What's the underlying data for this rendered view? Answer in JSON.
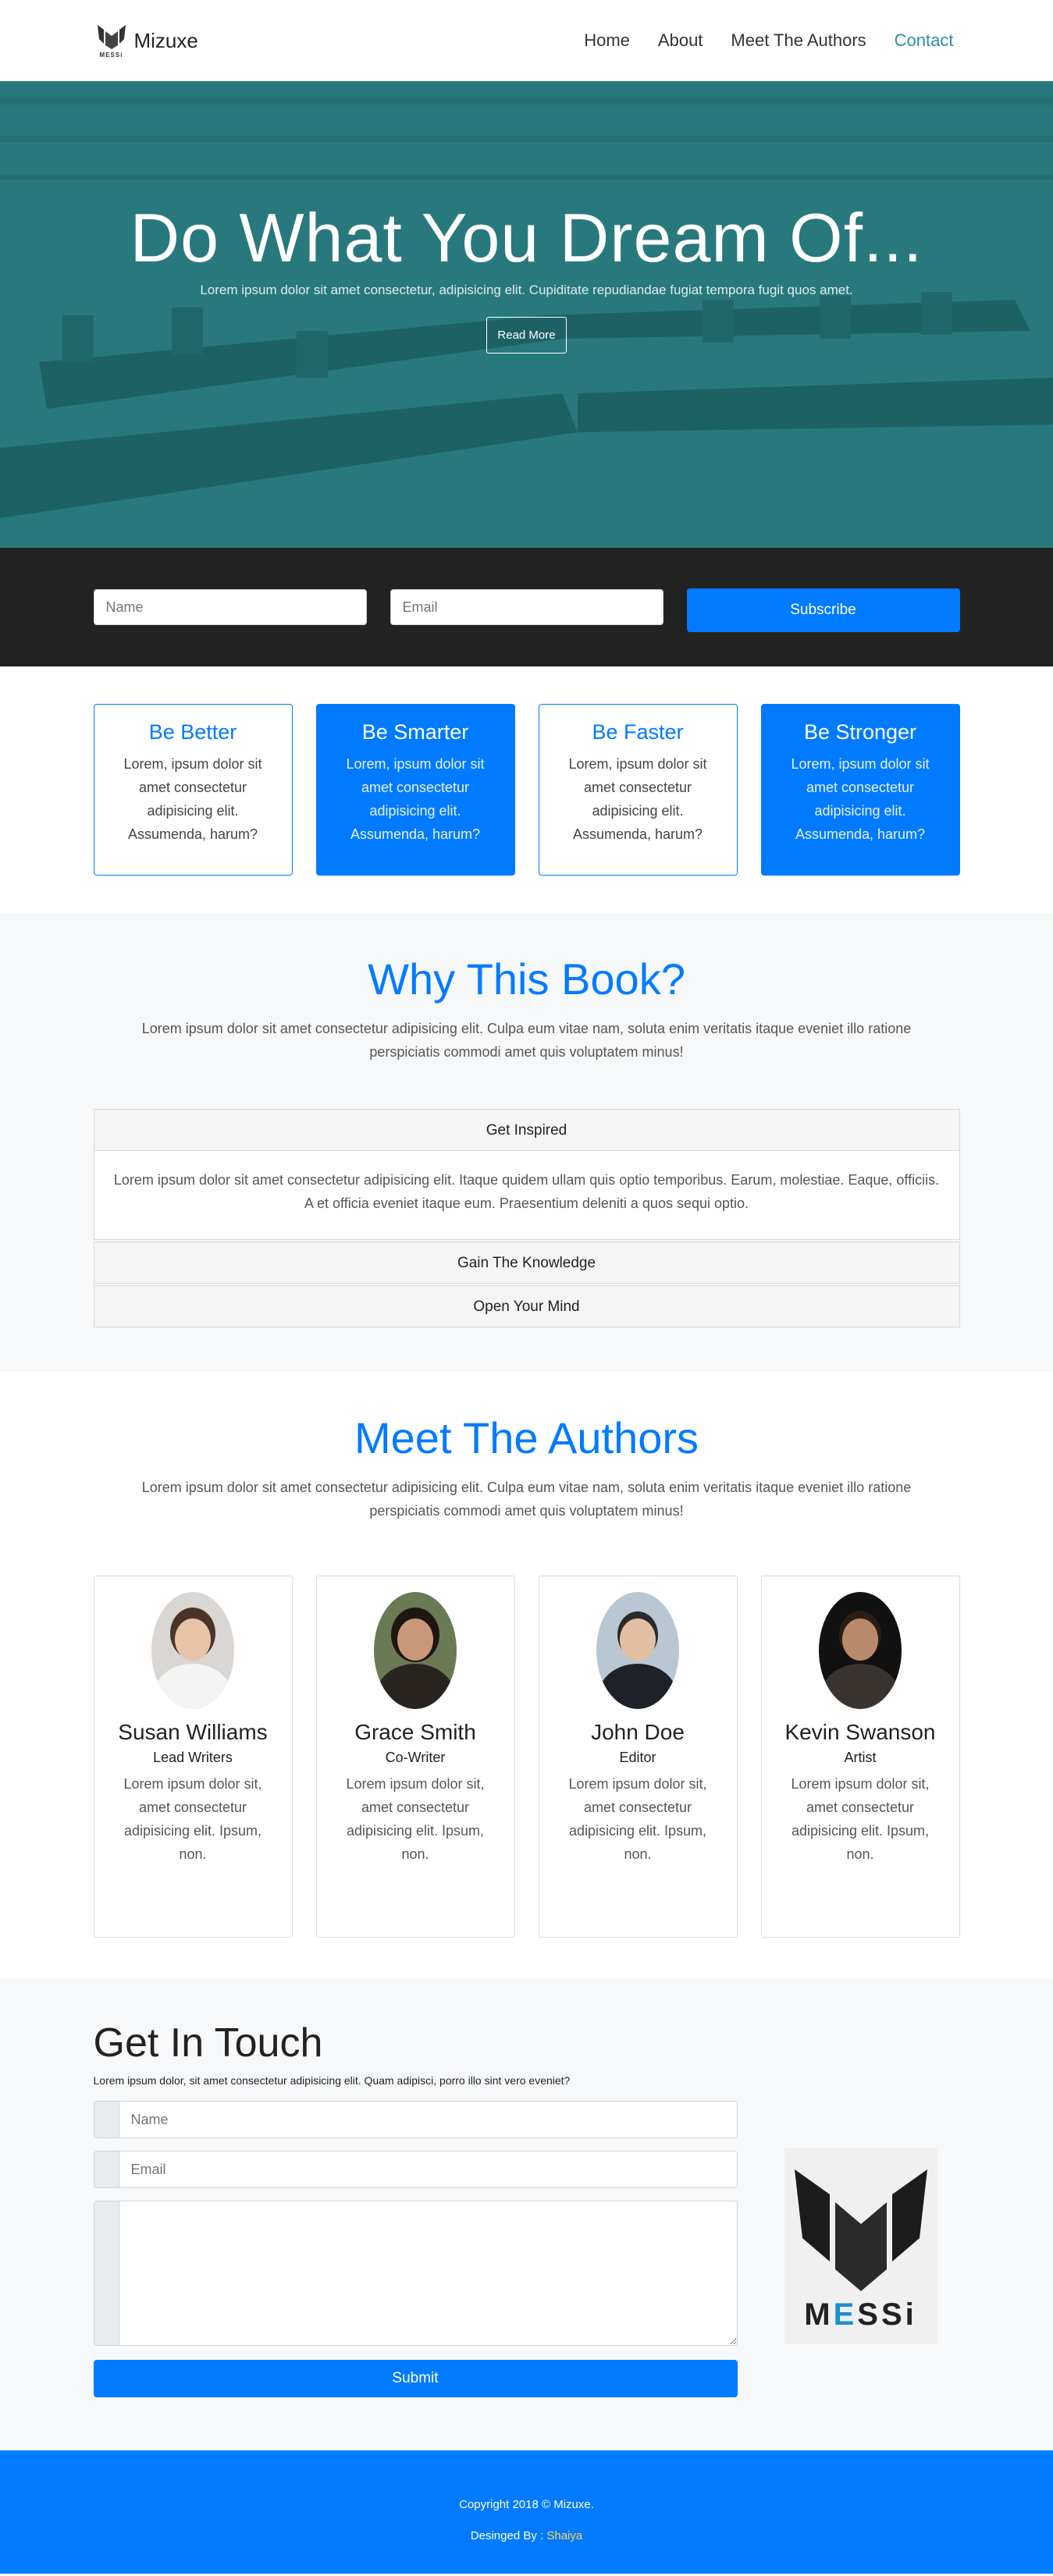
{
  "nav": {
    "brand": "Mizuxe",
    "brand_logo_word": "MESSi",
    "links": [
      "Home",
      "About",
      "Meet The Authors",
      "Contact"
    ]
  },
  "hero": {
    "title": "Do What You Dream Of...",
    "subtitle": "Lorem ipsum dolor sit amet consectetur, adipisicing elit. Cupiditate repudiandae fugiat tempora fugit quos amet.",
    "button": "Read More"
  },
  "subscribe": {
    "name_placeholder": "Name",
    "email_placeholder": "Email",
    "button": "Subscribe"
  },
  "features": [
    {
      "title": "Be Better",
      "text": "Lorem, ipsum dolor sit amet consectetur adipisicing elit. Assumenda, harum?"
    },
    {
      "title": "Be Smarter",
      "text": "Lorem, ipsum dolor sit amet consectetur adipisicing elit. Assumenda, harum?"
    },
    {
      "title": "Be Faster",
      "text": "Lorem, ipsum dolor sit amet consectetur adipisicing elit. Assumenda, harum?"
    },
    {
      "title": "Be Stronger",
      "text": "Lorem, ipsum dolor sit amet consectetur adipisicing elit. Assumenda, harum?"
    }
  ],
  "why": {
    "title": "Why This Book?",
    "lead": "Lorem ipsum dolor sit amet consectetur adipisicing elit. Culpa eum vitae nam, soluta enim veritatis itaque eveniet illo ratione perspiciatis commodi amet quis voluptatem minus!",
    "accordion": [
      {
        "title": "Get Inspired",
        "body": "Lorem ipsum dolor sit amet consectetur adipisicing elit. Itaque quidem ullam quis optio temporibus. Earum, molestiae. Eaque, officiis. A et officia eveniet itaque eum. Praesentium deleniti a quos sequi optio."
      },
      {
        "title": "Gain The Knowledge"
      },
      {
        "title": "Open Your Mind"
      }
    ]
  },
  "authors": {
    "title": "Meet The Authors",
    "lead": "Lorem ipsum dolor sit amet consectetur adipisicing elit. Culpa eum vitae nam, soluta enim veritatis itaque eveniet illo ratione perspiciatis commodi amet quis voluptatem minus!",
    "people": [
      {
        "name": "Susan Williams",
        "role": "Lead Writers",
        "text": "Lorem ipsum dolor sit, amet consectetur adipisicing elit. Ipsum, non."
      },
      {
        "name": "Grace Smith",
        "role": "Co-Writer",
        "text": "Lorem ipsum dolor sit, amet consectetur adipisicing elit. Ipsum, non."
      },
      {
        "name": "John Doe",
        "role": "Editor",
        "text": "Lorem ipsum dolor sit, amet consectetur adipisicing elit. Ipsum, non."
      },
      {
        "name": "Kevin Swanson",
        "role": "Artist",
        "text": "Lorem ipsum dolor sit, amet consectetur adipisicing elit. Ipsum, non."
      }
    ]
  },
  "contact": {
    "title": "Get In Touch",
    "intro": "Lorem ipsum dolor, sit amet consectetur adipisicing elit. Quam adipisci, porro illo sint vero eveniet?",
    "name_placeholder": "Name",
    "email_placeholder": "Email",
    "button": "Submit",
    "logo_word_left": "M",
    "logo_word_mid": "E",
    "logo_word_right": "SSi"
  },
  "footer": {
    "copyright": "Copyright 2018 © Mizuxe.",
    "designed_prefix": "Desinged By :",
    "designer": "Shaiya"
  },
  "colors": {
    "primary": "#007bff",
    "nav_active": "#2c8ea6",
    "dark": "#222222",
    "designer_highlight": "#ffd24d"
  }
}
